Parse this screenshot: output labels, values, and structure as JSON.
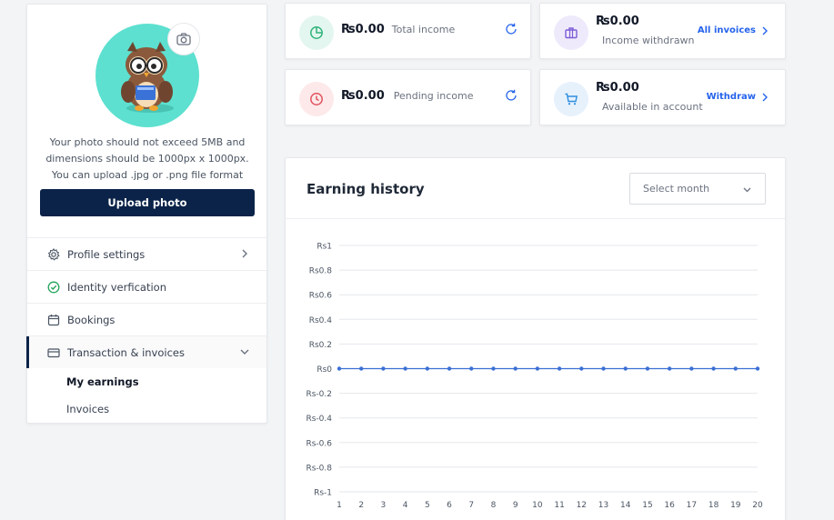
{
  "profile": {
    "photo_note": "Your photo should not exceed 5MB and dimensions should be 1000px x 1000px. You can upload .jpg or .png file format",
    "upload_label": "Upload photo"
  },
  "menu": {
    "profile_settings": "Profile settings",
    "identity": "Identity verfication",
    "bookings": "Bookings",
    "transactions": "Transaction & invoices",
    "sub": {
      "my_earnings": "My earnings",
      "invoices": "Invoices"
    }
  },
  "stats": {
    "total_income": {
      "amount": "₨0.00",
      "label": "Total income"
    },
    "pending_income": {
      "amount": "₨0.00",
      "label": "Pending income"
    },
    "withdrawn": {
      "amount": "₨0.00",
      "label": "Income withdrawn",
      "link": "All invoices"
    },
    "available": {
      "amount": "₨0.00",
      "label": "Available in account",
      "link": "Withdraw"
    }
  },
  "earnings": {
    "title": "Earning history",
    "select_placeholder": "Select month"
  },
  "icons": {
    "camera": "camera-icon",
    "settings": "gear-icon",
    "identity": "check-circle-icon",
    "bookings": "calendar-icon",
    "transactions": "credit-card-icon",
    "total": "pie-chart-icon",
    "pending": "clock-icon",
    "withdrawn": "briefcase-icon",
    "available": "cart-icon",
    "refresh": "refresh-icon"
  },
  "colors": {
    "primary": "#0b2348",
    "link": "#2563eb",
    "series": "#3b6fd4",
    "avatar_bg": "#5de0cf"
  },
  "chart_data": {
    "type": "line",
    "x": [
      1,
      2,
      3,
      4,
      5,
      6,
      7,
      8,
      9,
      10,
      11,
      12,
      13,
      14,
      15,
      16,
      17,
      18,
      19,
      20
    ],
    "series": [
      {
        "values": [
          0,
          0,
          0,
          0,
          0,
          0,
          0,
          0,
          0,
          0,
          0,
          0,
          0,
          0,
          0,
          0,
          0,
          0,
          0,
          0
        ]
      }
    ],
    "ylim": [
      -1,
      1
    ],
    "yticks": [
      "Rs1",
      "Rs0.8",
      "Rs0.6",
      "Rs0.4",
      "Rs0.2",
      "Rs0",
      "Rs-0.2",
      "Rs-0.4",
      "Rs-0.6",
      "Rs-0.8",
      "Rs-1"
    ],
    "ytick_values": [
      1,
      0.8,
      0.6,
      0.4,
      0.2,
      0,
      -0.2,
      -0.4,
      -0.6,
      -0.8,
      -1
    ],
    "grid": true,
    "legend": "none"
  }
}
